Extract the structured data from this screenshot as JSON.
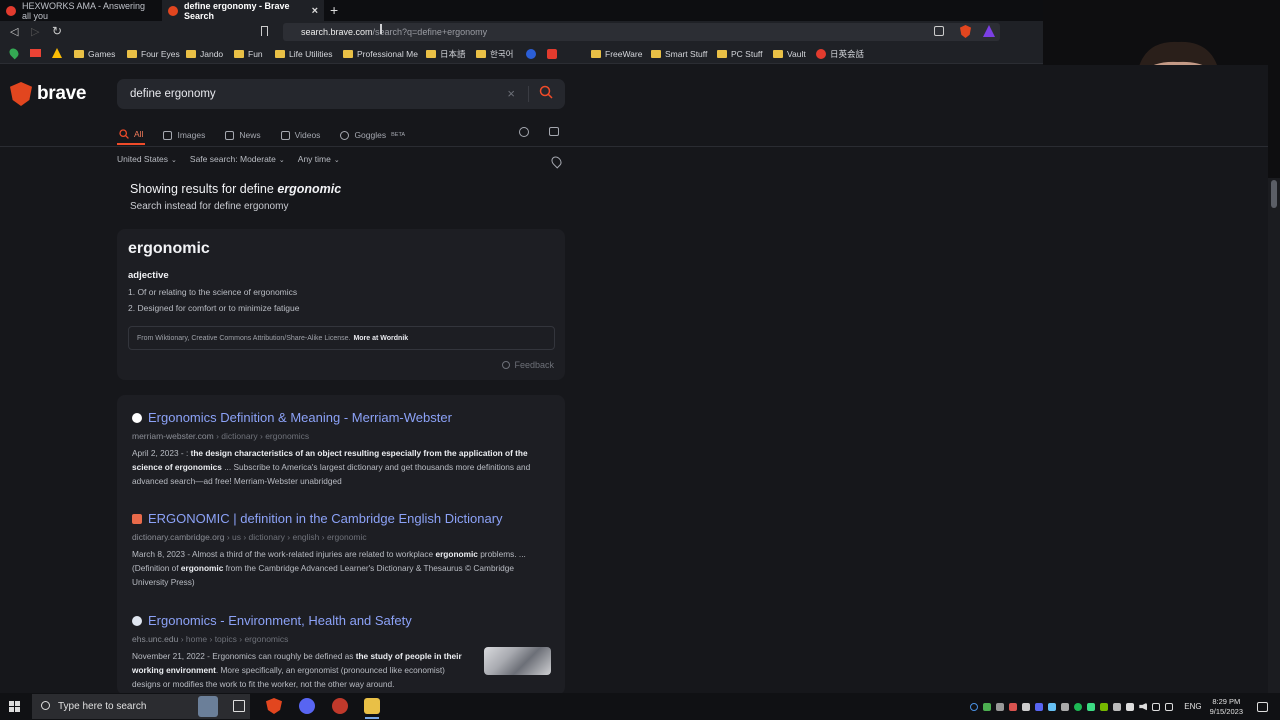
{
  "browser": {
    "tabs": [
      {
        "title": "HEXWORKS AMA - Answering all you",
        "close": "×",
        "favicon_color": "#e23b2e"
      },
      {
        "title": "define ergonomy - Brave Search",
        "close": "×",
        "favicon_color": "#e2461f"
      }
    ],
    "new_tab": "+",
    "url_host": "search.brave.com",
    "url_path": "/search?q=define+ergonomy",
    "bookmarks": [
      {
        "label": "Games",
        "icon": "folder-icon"
      },
      {
        "label": "Four Eyes",
        "icon": "folder-icon"
      },
      {
        "label": "Jando",
        "icon": "folder-icon"
      },
      {
        "label": "Fun",
        "icon": "folder-icon"
      },
      {
        "label": "Life Utilities",
        "icon": "folder-icon"
      },
      {
        "label": "Professional Me",
        "icon": "folder-icon"
      },
      {
        "label": "日本語",
        "icon": "folder-icon"
      },
      {
        "label": "한국어",
        "icon": "folder-icon"
      },
      {
        "label": "",
        "icon": "d-site-icon"
      },
      {
        "label": "",
        "icon": "t-site-icon"
      },
      {
        "label": "FreeWare",
        "icon": "folder-icon"
      },
      {
        "label": "Smart Stuff",
        "icon": "folder-icon"
      },
      {
        "label": "PC Stuff",
        "icon": "folder-icon"
      },
      {
        "label": "Vault",
        "icon": "folder-icon"
      },
      {
        "label": "日英会話",
        "icon": "e-site-icon"
      }
    ]
  },
  "brave": {
    "logo_text": "brave",
    "query": "define ergonomy",
    "clear_glyph": "×",
    "tabs": [
      {
        "label": "All",
        "active": true
      },
      {
        "label": "Images",
        "active": false
      },
      {
        "label": "News",
        "active": false
      },
      {
        "label": "Videos",
        "active": false
      },
      {
        "label": "Goggles",
        "badge": "BETA",
        "active": false
      }
    ],
    "filters": [
      {
        "label": "United States",
        "chevron": "⌄"
      },
      {
        "label": "Safe search: Moderate",
        "chevron": "⌄"
      },
      {
        "label": "Any time",
        "chevron": "⌄"
      }
    ],
    "showing_prefix": "Showing results for define",
    "showing_term": "ergonomic",
    "instead_prefix": "Search instead for",
    "instead_term": "define ergonomy",
    "definition": {
      "word": "ergonomic",
      "part_of_speech": "adjective",
      "senses": [
        "1. Of or relating to the science of ergonomics",
        "2. Designed for comfort or to minimize fatigue"
      ],
      "attribution": "From Wiktionary, Creative Commons Attribution/Share-Alike License.",
      "attribution_link": "More at Wordnik",
      "feedback": "Feedback"
    },
    "results": [
      {
        "title": "Ergonomics Definition & Meaning - Merriam-Webster",
        "site": "merriam-webster.com",
        "crumbs": " › dictionary › ergonomics",
        "date": "April 2, 2023 - : ",
        "bold1": "the design characteristics of an object resulting especially from the application of the science of ergonomics",
        "rest": " ... Subscribe to America's largest dictionary and get thousands more definitions and advanced search—ad free! Merriam-Webster unabridged",
        "favicon_color": "#ffffff"
      },
      {
        "title": "ERGONOMIC | definition in the Cambridge English Dictionary",
        "site": "dictionary.cambridge.org",
        "crumbs": " › us › dictionary › english › ergonomic",
        "date": "March 8, 2023 - ",
        "text1": "Almost a third of the work-related injuries are related to workplace ",
        "bold1": "ergonomic",
        "text2": " problems. ... (Definition of ",
        "bold2": "ergonomic",
        "text3": " from the Cambridge Advanced Learner's Dictionary & Thesaurus © Cambridge University Press)",
        "favicon_color": "#e86a4a"
      },
      {
        "title": "Ergonomics - Environment, Health and Safety",
        "site": "ehs.unc.edu",
        "crumbs": " › home › topics › ergonomics",
        "date": "November 21, 2022 - ",
        "text1": "Ergonomics can roughly be defined as ",
        "bold1": "the study of people in their working environment",
        "text2": ". More specifically, an ergonomist (pronounced like economist) designs or modifies the work to fit the worker, not the other way around.",
        "favicon_color": "#e0e6f0"
      }
    ]
  },
  "taskbar": {
    "search_placeholder": "Type here to search",
    "language": "ENG",
    "time": "8:29 PM",
    "date": "9/15/2023"
  },
  "colors": {
    "accent": "#f04b29",
    "link": "#8ca2f7",
    "background": "#16171b",
    "card": "#1d1e23"
  }
}
